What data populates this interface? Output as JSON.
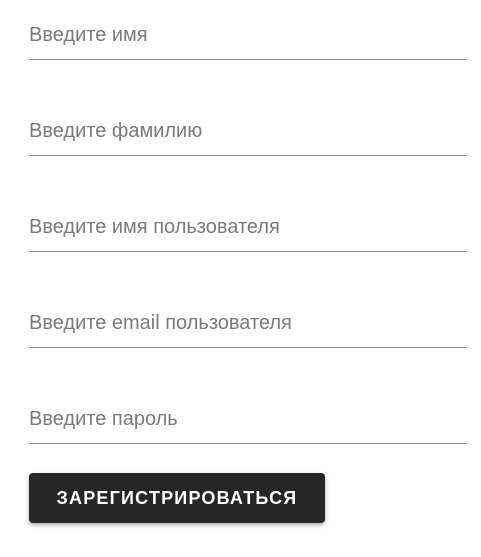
{
  "form": {
    "fields": [
      {
        "placeholder": "Введите имя",
        "value": ""
      },
      {
        "placeholder": "Введите фамилию",
        "value": ""
      },
      {
        "placeholder": "Введите имя пользователя",
        "value": ""
      },
      {
        "placeholder": "Введите email пользователя",
        "value": ""
      },
      {
        "placeholder": "Введите пароль",
        "value": ""
      }
    ],
    "submit_label": "ЗАРЕГИСТРИРОВАТЬСЯ"
  },
  "colors": {
    "button_bg": "#262626",
    "button_text": "#ffffff",
    "underline": "#8c8c8c",
    "placeholder": "#7a7a7a"
  }
}
